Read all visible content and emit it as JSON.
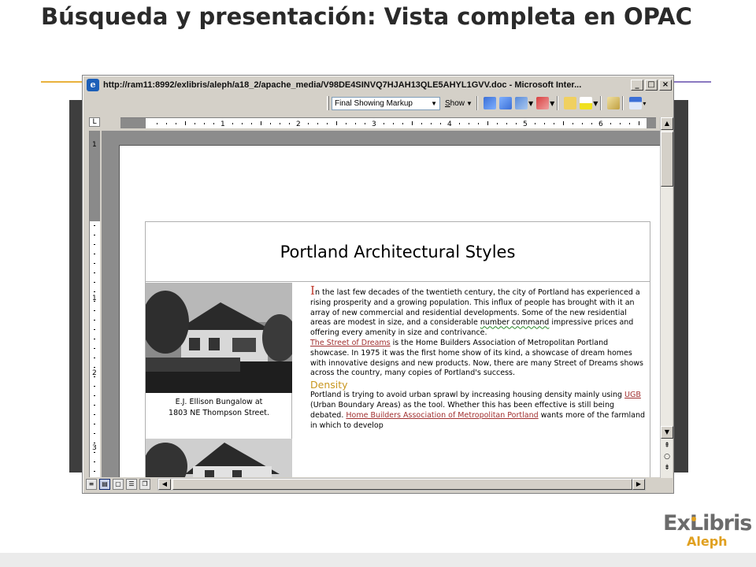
{
  "slide": {
    "title": "Búsqueda y presentación: Vista completa en OPAC"
  },
  "window": {
    "title": "http://ram11:8992/exlibris/aleph/a18_2/apache_media/V98DE4SINVQ7HJAH13QLE5AHYL1GVV.doc - Microsoft Inter...",
    "minimize": "_",
    "maximize": "□",
    "close": "×"
  },
  "toolbar": {
    "markup_mode": "Final Showing Markup",
    "show_label": "Show",
    "show_accel": "S",
    "show_rest": "how",
    "icons": [
      "previous-change-icon",
      "next-change-icon",
      "accept-change-icon",
      "reject-change-icon",
      "new-comment-icon",
      "highlight-icon",
      "track-changes-icon",
      "reviewing-pane-icon"
    ]
  },
  "ruler": {
    "h_numbers": [
      "1",
      "2",
      "3",
      "4",
      "5",
      "6"
    ],
    "v_numbers": [
      "1",
      "1",
      "2",
      "3"
    ]
  },
  "document": {
    "table_title": "Portland Architectural Styles",
    "photo1_caption_line1": "E.J. Ellison Bungalow at",
    "photo1_caption_line2": "1803 NE Thompson Street.",
    "drop_cap": "I",
    "para1_a": "n the last few decades of the twentieth century, the city of Portland has experienced a rising prosperity and a growing population.  This influx of people has brought with it an array of new commercial and residential developments.  Some of the new residential areas are modest in size, and a considerable ",
    "para1_squiggle": "number  command",
    "para1_b": " impressive prices and offering every amenity in size and contrivance.",
    "link_street": "The Street of Dreams",
    "para2": " is the Home Builders Association of Metropolitan Portland showcase.  In 1975 it was the first home show of its kind, a showcase of dream homes with innovative designs and new products.  Now, there are many Street of Dreams shows across the country, many copies of Portland's success.",
    "density_heading": "Density",
    "para3_a": "Portland is trying to avoid urban sprawl by increasing housing density mainly using ",
    "link_ugb": "UGB",
    "para3_b": " (Urban Boundary Areas) as the tool.  Whether this has been effective is still being debated.  ",
    "link_hba": "Home Builders Association of Metropolitan Portland",
    "para3_c": " wants more of the farmland in which to develop"
  },
  "statusbar": {
    "view_buttons": [
      "normal-view",
      "web-layout-view",
      "print-layout-view",
      "outline-view",
      "reading-view"
    ]
  },
  "logo": {
    "main": "ExLibris",
    "sub": "Aleph"
  },
  "colors": {
    "title": "#2a2a2a",
    "accent_orange": "#e9b23c",
    "accent_purple": "#8a78c0",
    "link": "#a03030",
    "density": "#c8961e",
    "backdrop": "#3e3e3e"
  }
}
